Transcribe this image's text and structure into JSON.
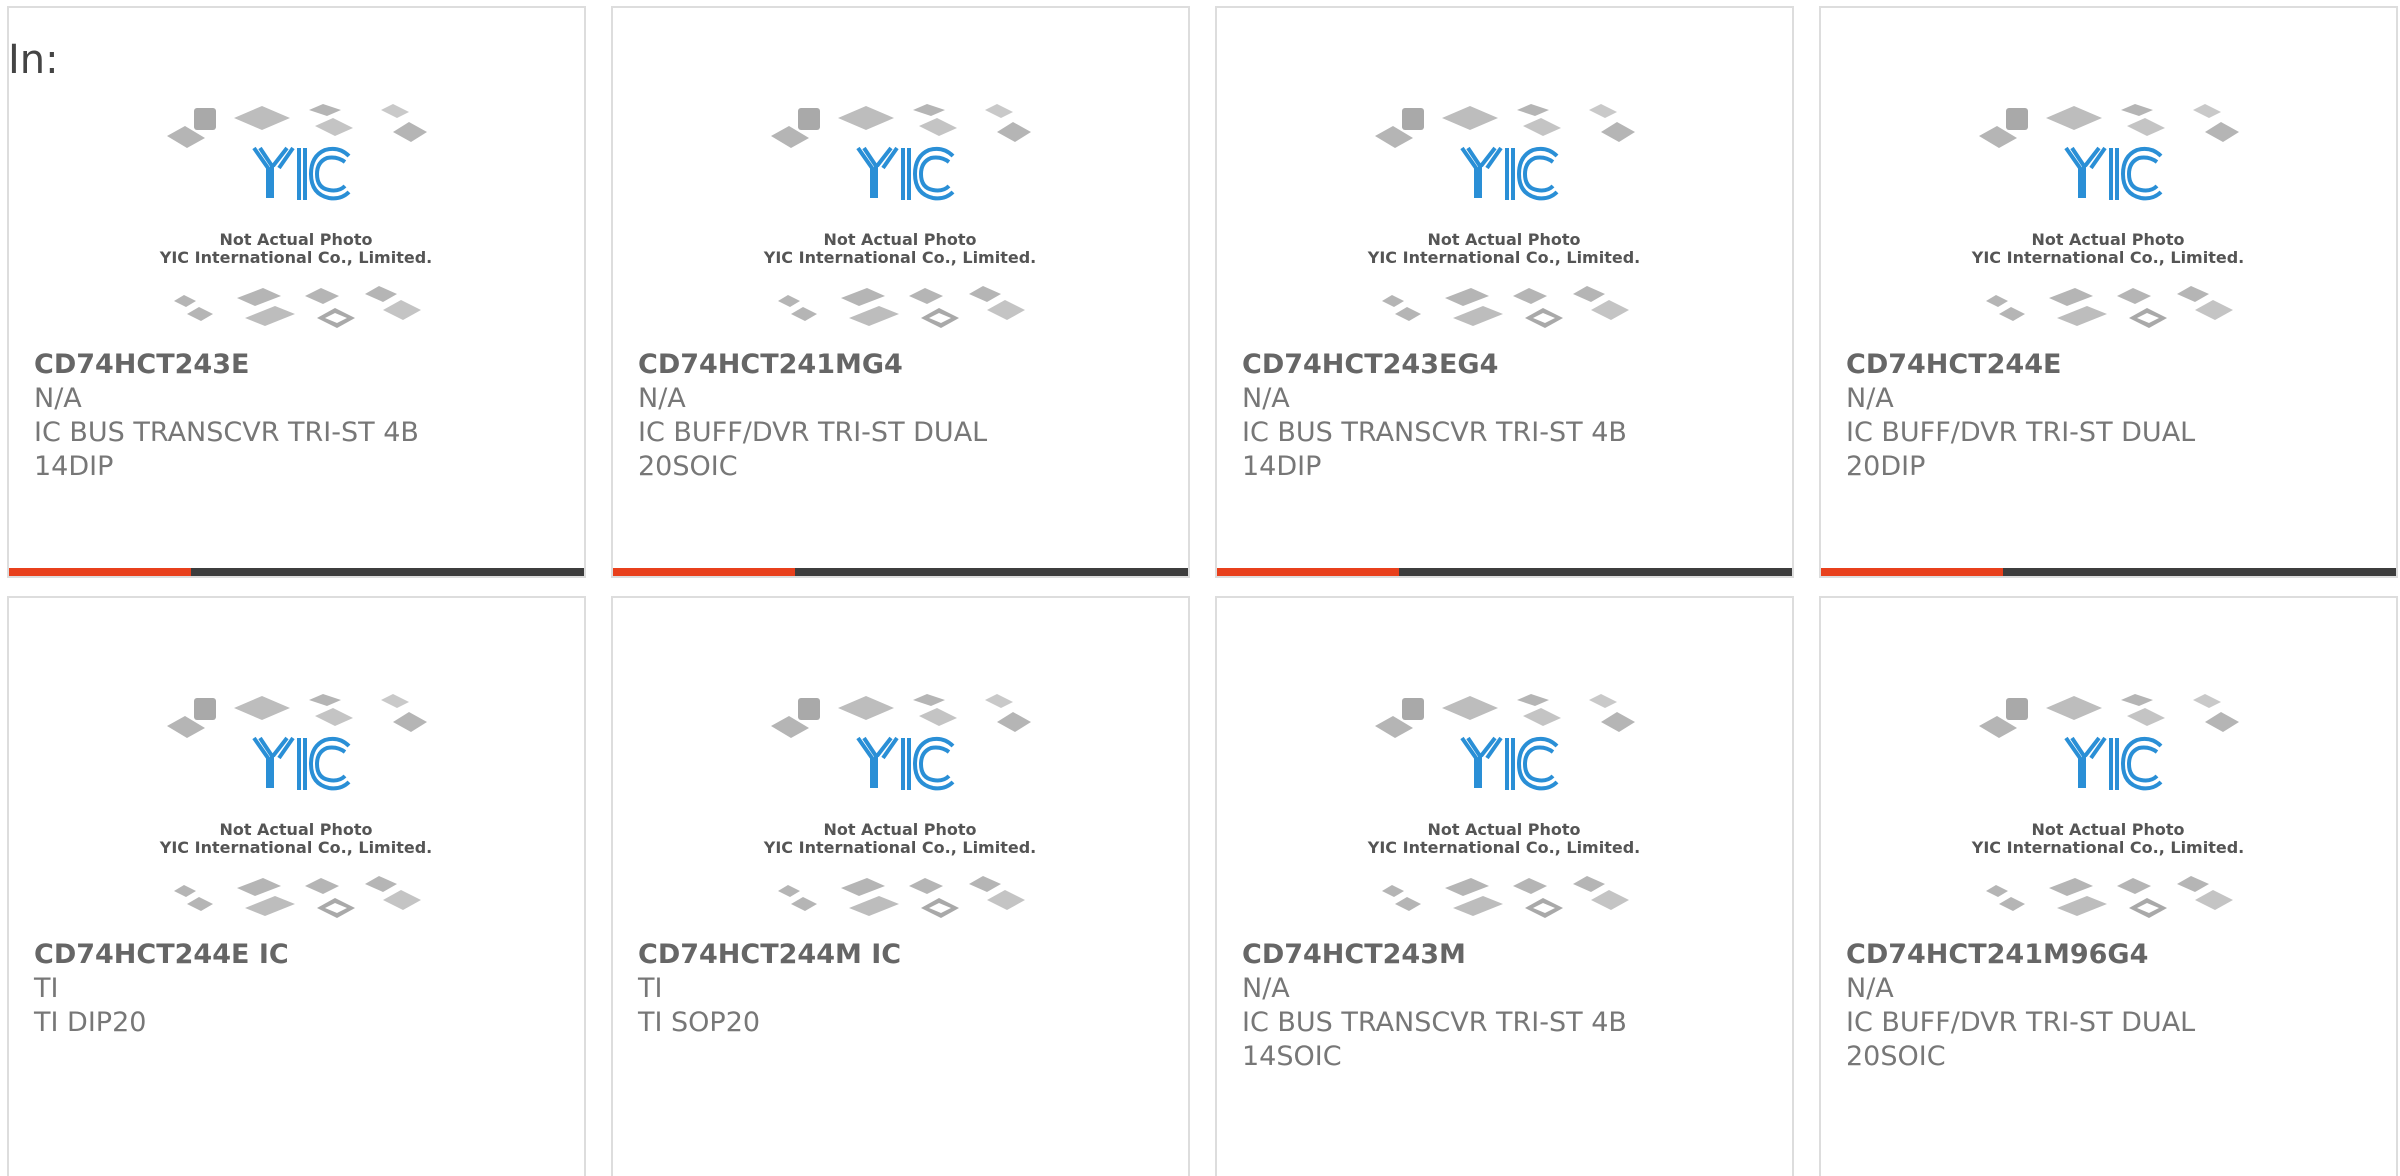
{
  "page": {
    "label": "In:"
  },
  "placeholder": {
    "line1": "Not Actual Photo",
    "line2": "YIC International Co., Limited.",
    "logo_text": "YIC"
  },
  "colors": {
    "accent": "#e8401c",
    "bar": "#3d3d3d",
    "logo": "#2a8fd6",
    "chips": "#b5b5b5"
  },
  "products": [
    {
      "part": "CD74HCT243E",
      "manufacturer": "N/A",
      "description": "IC BUS TRANSCVR TRI-ST 4B 14DIP"
    },
    {
      "part": "CD74HCT241MG4",
      "manufacturer": "N/A",
      "description": "IC BUFF/DVR TRI-ST DUAL 20SOIC"
    },
    {
      "part": "CD74HCT243EG4",
      "manufacturer": "N/A",
      "description": "IC BUS TRANSCVR TRI-ST 4B 14DIP"
    },
    {
      "part": "CD74HCT244E",
      "manufacturer": "N/A",
      "description": "IC BUFF/DVR TRI-ST DUAL 20DIP"
    },
    {
      "part": "CD74HCT244E IC",
      "manufacturer": "TI",
      "description": "TI DIP20"
    },
    {
      "part": "CD74HCT244M IC",
      "manufacturer": "TI",
      "description": "TI SOP20"
    },
    {
      "part": "CD74HCT243M",
      "manufacturer": "N/A",
      "description": "IC BUS TRANSCVR TRI-ST 4B 14SOIC"
    },
    {
      "part": "CD74HCT241M96G4",
      "manufacturer": "N/A",
      "description": "IC BUFF/DVR TRI-ST DUAL 20SOIC"
    }
  ]
}
